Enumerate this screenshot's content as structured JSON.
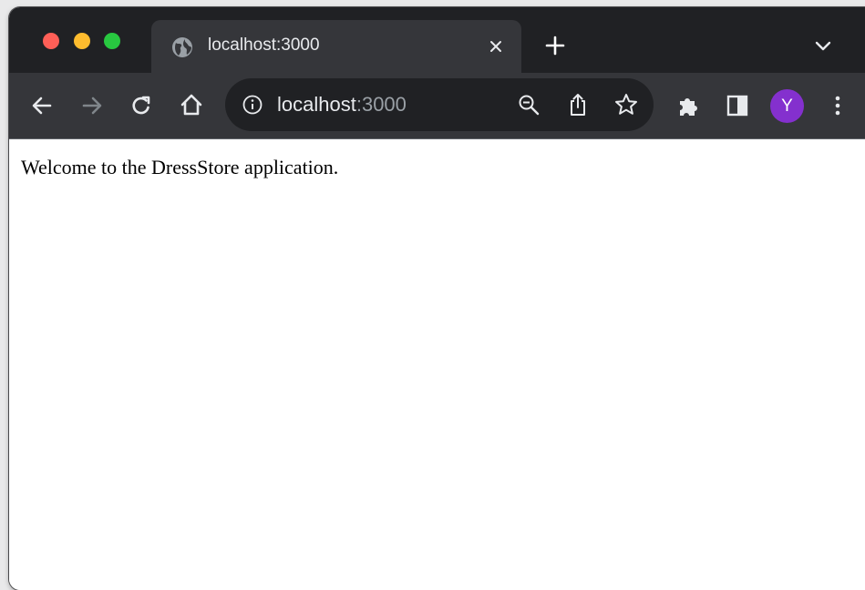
{
  "browser": {
    "tab": {
      "title": "localhost:3000",
      "icon": "globe-icon",
      "close_icon": "close-icon"
    },
    "new_tab_icon": "plus-icon",
    "tab_search_icon": "chevron-down-icon",
    "toolbar": {
      "back_icon": "arrow-left-icon",
      "forward_icon": "arrow-right-icon",
      "reload_icon": "reload-icon",
      "home_icon": "home-icon",
      "extensions_icon": "puzzle-icon",
      "side_panel_icon": "side-panel-icon",
      "menu_icon": "kebab-menu-icon"
    },
    "omnibox": {
      "site_info_icon": "info-icon",
      "url_host": "localhost",
      "url_port": ":3000",
      "zoom_icon": "zoom-out-icon",
      "share_icon": "share-icon",
      "bookmark_icon": "star-icon"
    },
    "profile": {
      "initial": "Y",
      "color": "#8430ce"
    }
  },
  "page": {
    "welcome_text": "Welcome to the DressStore application."
  }
}
